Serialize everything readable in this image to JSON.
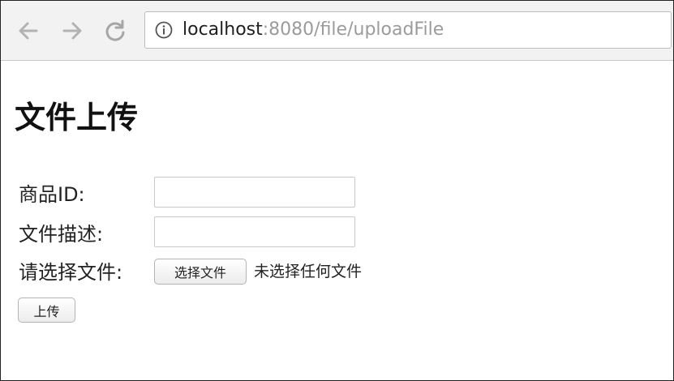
{
  "browser": {
    "url_host": "localhost",
    "url_rest": ":8080/file/uploadFile",
    "back_icon": "arrow-left",
    "forward_icon": "arrow-right",
    "reload_icon": "refresh",
    "info_icon": "info-circle"
  },
  "page": {
    "title": "文件上传",
    "form": {
      "product_id_label": "商品ID:",
      "product_id_value": "",
      "description_label": "文件描述:",
      "description_value": "",
      "file_label": "请选择文件:",
      "choose_file_button": "选择文件",
      "no_file_text": "未选择任何文件",
      "upload_button": "上传"
    }
  }
}
